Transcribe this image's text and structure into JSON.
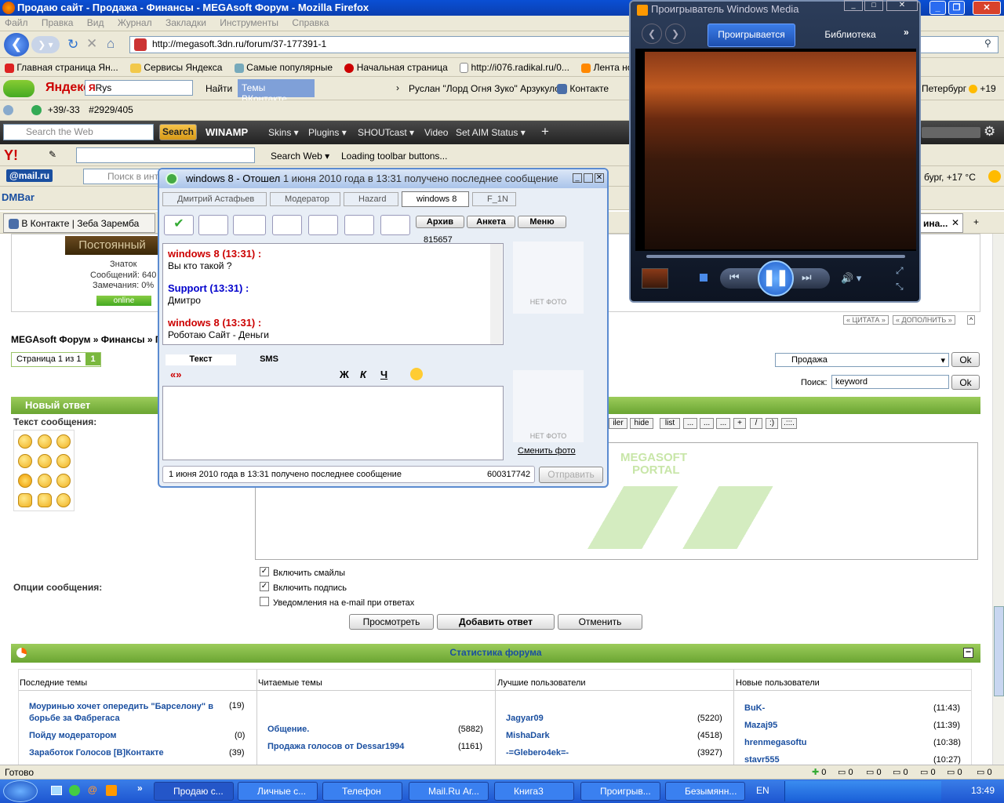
{
  "window": {
    "title": "Продаю сайт - Продажа - Финансы - MEGAsoft Форум - Mozilla Firefox"
  },
  "menu": [
    "Файл",
    "Правка",
    "Вид",
    "Журнал",
    "Закладки",
    "Инструменты",
    "Справка"
  ],
  "address": {
    "url": "http://megasoft.3dn.ru/forum/37-177391-1"
  },
  "bookmarks": [
    "Главная страница Ян...",
    "Сервисы Яндекса",
    "Самые популярные",
    "Начальная страница",
    "http://i076.radikal.ru/0...",
    "Лента ново"
  ],
  "yandex_bar": {
    "logo": "Яндекс",
    "query": "Rys",
    "find": "Найти",
    "vk_topics": "Темы ВКонтакте",
    "news": "Руслан \"Лорд Огня Зуко\" Арзукулов",
    "vk": "Контакте",
    "city": "Петербург",
    "temp": "+19"
  },
  "counter_bar": {
    "weather": "+39/-33",
    "count": "#2929/405"
  },
  "winamp_bar": {
    "search_placeholder": "Search the Web",
    "search_btn": "Search",
    "logo": "WINAMP",
    "skins": "Skins",
    "plugins": "Plugins",
    "shoutcast": "SHOUTcast",
    "video": "Video",
    "aim": "Set AIM Status"
  },
  "yahoo_bar": {
    "search_web": "Search Web",
    "loading": "Loading toolbar buttons..."
  },
  "mailru_bar": {
    "logo": "@mail.ru",
    "search_placeholder": "Поиск в инт",
    "city_temp": "бург, +17 °C"
  },
  "dmbar": {
    "label": "DMBar"
  },
  "tabs": {
    "left": "В Контакте | Зеба Заремба",
    "right": "ина..."
  },
  "profile": {
    "rank_img": "Постоянный",
    "rank": "Знаток",
    "messages": "Сообщений: 640",
    "warnings": "Замечания: 0%",
    "status": "online"
  },
  "breadcrumb": "MEGAsoft Форум » Финансы » Пр",
  "pagination": {
    "label": "Страница 1 из 1",
    "current": "1"
  },
  "post_actions": {
    "quote": "ЦИТАТА",
    "add": "ДОПОЛНИТЬ"
  },
  "jump": {
    "select": "Продажа",
    "ok": "Ok",
    "search_label": "Поиск:",
    "search_value": "keyword",
    "search_ok": "Ok"
  },
  "reply": {
    "header": "Новый ответ",
    "text_label": "Текст сообщения:",
    "options_label": "Опции сообщения:",
    "opt_smiles": "Включить смайлы",
    "opt_sign": "Включить подпись",
    "opt_email": "Уведомления на e-mail при ответах",
    "preview": "Просмотреть",
    "submit": "Добавить ответ",
    "cancel": "Отменить"
  },
  "format_buttons": [
    "iler",
    "hide",
    "list",
    "...",
    "...",
    "...",
    "+",
    "/",
    ":)",
    ".:::."
  ],
  "watermark": {
    "line1": "MEGASOFT",
    "line2": "PORTAL"
  },
  "stats": {
    "header": "Статистика форума",
    "columns": [
      "Последние темы",
      "Читаемые темы",
      "Лучшие пользователи",
      "Новые пользователи"
    ],
    "recent": [
      {
        "title": "Моуринью хочет опередить \"Барселону\" в борьбе за Фабрегаса",
        "count": "(19)"
      },
      {
        "title": "Пойду модератором",
        "count": "(0)"
      },
      {
        "title": "Заработок Голосов [В]Контакте",
        "count": "(39)"
      }
    ],
    "popular": [
      {
        "title": "Общение.",
        "count": "(5882)"
      },
      {
        "title": "Продажа голосов от Dessar1994",
        "count": "(1161)"
      }
    ],
    "best": [
      {
        "name": "Jagyar09",
        "count": "(5220)"
      },
      {
        "name": "MishaDark",
        "count": "(4518)"
      },
      {
        "name": "-=Glebero4ek=-",
        "count": "(3927)"
      }
    ],
    "newusers": [
      {
        "name": "BuK-",
        "time": "(11:43)"
      },
      {
        "name": "Mazaj95",
        "time": "(11:39)"
      },
      {
        "name": "hrenmegasoftu",
        "time": "(10:38)"
      },
      {
        "name": "stavr555",
        "time": "(10:27)"
      }
    ]
  },
  "status_bar": {
    "text": "Готово",
    "counters": [
      "0",
      "0",
      "0",
      "0",
      "0",
      "0",
      "0"
    ]
  },
  "qip": {
    "title": "windows 8 - Отошел",
    "status": "1 июня 2010 года в 13:31 получено последнее сообщение",
    "tabs": [
      "Дмитрий Астафьев",
      "Модератор",
      "Hazard",
      "windows 8",
      "F_1N"
    ],
    "buttons": {
      "archive": "Архив",
      "profile": "Анкета",
      "menu": "Меню"
    },
    "uin": "815657",
    "messages": [
      {
        "author": "windows 8 (13:31) :",
        "text": "Вы кто такой ?"
      },
      {
        "author": "Support (13:31) :",
        "text": "Дмитро"
      },
      {
        "author": "windows 8 (13:31) :",
        "text": "Роботаю Сайт - Деньги"
      }
    ],
    "no_photo": "НЕТ ФОТО",
    "change_photo": "Сменить фото",
    "input_tabs": [
      "Текст",
      "SMS"
    ],
    "fmt": [
      "«»",
      "Ж",
      "К",
      "Ч"
    ],
    "num": "600317742",
    "send": "Отправить"
  },
  "wmp": {
    "title": "Проигрыватель Windows Media",
    "tab_playing": "Проигрывается",
    "tab_library": "Библиотека"
  },
  "taskbar": {
    "items": [
      "Продаю с...",
      "Личные с...",
      "Телефон",
      "Mail.Ru Аг...",
      "Книга3",
      "Проигрыв...",
      "Безымянн..."
    ],
    "lang": "EN",
    "clock": "13:49"
  },
  "colors": {
    "forum_green": "#7ab83e",
    "title_blue": "#0a4fd4",
    "qip_red": "#cc0000",
    "qip_blue": "#0000cc"
  }
}
